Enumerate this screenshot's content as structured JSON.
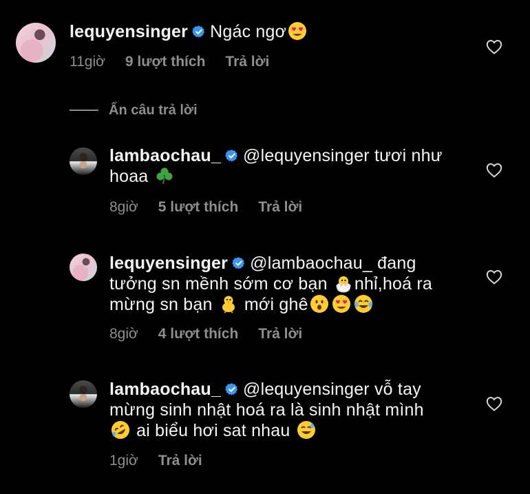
{
  "comments": [
    {
      "username": "lequyensinger",
      "text": "Ngác ngơ",
      "time": "11giờ",
      "likes": "9 lượt thích",
      "reply": "Trả lời"
    },
    {
      "username": "lambaochau_",
      "line1": "@lequyensinger tươi như",
      "line2": "hoaa",
      "time": "8giờ",
      "likes": "5 lượt thích",
      "reply": "Trả lời"
    },
    {
      "username": "lequyensinger",
      "line1": "@lambaochau_ đang",
      "line2a": "tưởng sn mềnh sớm cơ bạn",
      "line2b": "nhỉ,hoá ra",
      "line3a": "mừng sn bạn",
      "line3b": "mới ghê",
      "time": "8giờ",
      "likes": "4 lượt thích",
      "reply": "Trả lời"
    },
    {
      "username": "lambaochau_",
      "line1": "@lequyensinger vỗ tay",
      "line2": "mừng sinh nhật hoá ra là sinh nhật mình",
      "line3": "ai biểu hơi sat nhau",
      "time": "1giờ",
      "reply": "Trả lời"
    }
  ],
  "hide_replies_label": "Ẩn câu trả lời",
  "icons": {
    "verified": "verified-badge-icon",
    "heart": "heart-outline-icon",
    "emoji_heart_eyes": "heart-eyes-emoji",
    "emoji_shamrock": "shamrock-emoji",
    "emoji_hatching_chick": "hatching-chick-emoji",
    "emoji_baby_chick": "baby-chick-emoji",
    "emoji_open_mouth": "hushed-face-emoji",
    "emoji_joy": "tears-of-joy-emoji",
    "emoji_rofl": "rolling-laughing-emoji",
    "emoji_sweat_smile": "sweat-smile-emoji"
  },
  "colors": {
    "background": "#000000",
    "text": "#f5f5f5",
    "muted": "#8e8e8e",
    "verified_blue": "#3897f0"
  }
}
